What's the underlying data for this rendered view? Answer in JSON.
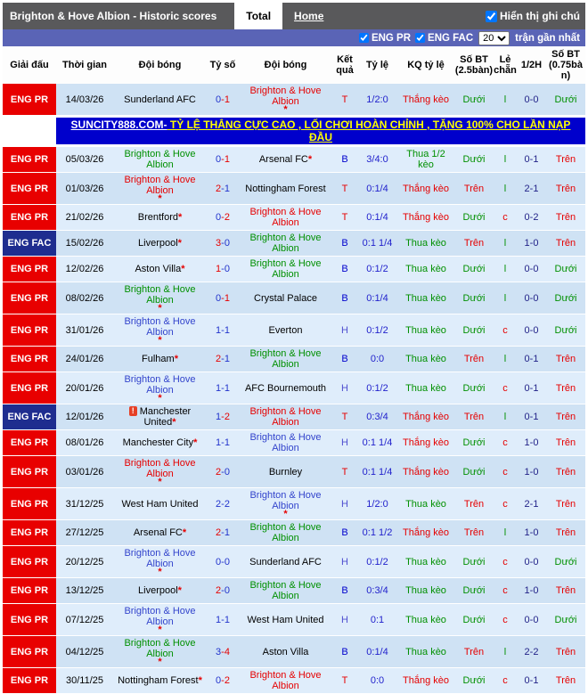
{
  "topbar": {
    "title": "Brighton & Hove Albion - Historic scores",
    "tabs": [
      {
        "label": "Total",
        "active": true
      },
      {
        "label": "Home",
        "active": false
      }
    ],
    "note_checkbox_label": "Hiển thị ghi chú"
  },
  "filterbar": {
    "checkboxes": [
      {
        "label": "ENG PR",
        "checked": true
      },
      {
        "label": "ENG FAC",
        "checked": true
      }
    ],
    "match_count_value": "20",
    "suffix_label": "trận gần nhất"
  },
  "symbols": {
    "star": "*",
    "red_card": "!",
    "dash": "-"
  },
  "colors": {
    "league_pr_bg": "#e80000",
    "league_fac_bg": "#1e2d8f",
    "team_win": "#e60000",
    "team_loss": "#009000",
    "team_draw": "#3344cc",
    "score_winner": "#e60000",
    "score_loser": "#2233cc",
    "over": "#e60000",
    "under": "#009000",
    "bar_blue": "#5a64b6",
    "topbar_gray": "#59595b",
    "ad_bg": "#0000cc",
    "ad_text": "#ffff00"
  },
  "table": {
    "headers": [
      "Giải đấu",
      "Thời gian",
      "Đội bóng",
      "Tỷ số",
      "Đội bóng",
      "Kết quả",
      "Tỷ lệ",
      "KQ tỷ lệ",
      "Số BT (2.5bàn)",
      "Lẻ chẵn",
      "1/2H",
      "Số BT (0.75bàn)"
    ],
    "ad_row": {
      "text_prefix": "SUNCITY888.COM-",
      "text_main": " TỶ LỆ THẮNG CỰC CAO , LỐI CHƠI HOÀN CHỈNH , TẶNG 100% CHO LẦN NẠP ĐẦU"
    },
    "rows": [
      {
        "league": "ENG PR",
        "lstyle": "pr",
        "date": "14/03/26",
        "home": {
          "name": "Sunderland AFC",
          "result": "none"
        },
        "score": {
          "h": "0",
          "a": "1"
        },
        "away": {
          "name": "Brighton & Hove Albion",
          "result": "win",
          "star": true,
          "star_below": true
        },
        "result": "T",
        "odds": "1/2:0",
        "odds_result": "Thắng kèo",
        "over25": "Dưới",
        "odd_even": "l",
        "half": "0-0",
        "over075": "Dưới"
      },
      {
        "league": "ENG PR",
        "lstyle": "pr",
        "date": "05/03/26",
        "home": {
          "name": "Brighton & Hove Albion",
          "result": "loss"
        },
        "score": {
          "h": "0",
          "a": "1"
        },
        "away": {
          "name": "Arsenal FC",
          "result": "none",
          "star": true
        },
        "result": "B",
        "odds": "3/4:0",
        "odds_result": "Thua 1/2 kèo",
        "over25": "Dưới",
        "odd_even": "l",
        "half": "0-1",
        "over075": "Trên"
      },
      {
        "league": "ENG PR",
        "lstyle": "pr",
        "date": "01/03/26",
        "home": {
          "name": "Brighton & Hove Albion",
          "result": "win",
          "star": true,
          "star_below": true
        },
        "score": {
          "h": "2",
          "a": "1"
        },
        "away": {
          "name": "Nottingham Forest",
          "result": "none"
        },
        "result": "T",
        "odds": "0:1/4",
        "odds_result": "Thắng kèo",
        "over25": "Trên",
        "odd_even": "l",
        "half": "2-1",
        "over075": "Trên"
      },
      {
        "league": "ENG PR",
        "lstyle": "pr",
        "date": "21/02/26",
        "home": {
          "name": "Brentford",
          "result": "none",
          "star": true
        },
        "score": {
          "h": "0",
          "a": "2"
        },
        "away": {
          "name": "Brighton & Hove Albion",
          "result": "win"
        },
        "result": "T",
        "odds": "0:1/4",
        "odds_result": "Thắng kèo",
        "over25": "Dưới",
        "odd_even": "c",
        "half": "0-2",
        "over075": "Trên"
      },
      {
        "league": "ENG FAC",
        "lstyle": "fac",
        "date": "15/02/26",
        "home": {
          "name": "Liverpool",
          "result": "none",
          "star": true
        },
        "score": {
          "h": "3",
          "a": "0"
        },
        "away": {
          "name": "Brighton & Hove Albion",
          "result": "loss"
        },
        "result": "B",
        "odds": "0:1 1/4",
        "odds_result": "Thua kèo",
        "over25": "Trên",
        "odd_even": "l",
        "half": "1-0",
        "over075": "Trên"
      },
      {
        "league": "ENG PR",
        "lstyle": "pr",
        "date": "12/02/26",
        "home": {
          "name": "Aston Villa",
          "result": "none",
          "star": true
        },
        "score": {
          "h": "1",
          "a": "0"
        },
        "away": {
          "name": "Brighton & Hove Albion",
          "result": "loss"
        },
        "result": "B",
        "odds": "0:1/2",
        "odds_result": "Thua kèo",
        "over25": "Dưới",
        "odd_even": "l",
        "half": "0-0",
        "over075": "Dưới"
      },
      {
        "league": "ENG PR",
        "lstyle": "pr",
        "date": "08/02/26",
        "home": {
          "name": "Brighton & Hove Albion",
          "result": "loss",
          "star": true,
          "star_below": true
        },
        "score": {
          "h": "0",
          "a": "1"
        },
        "away": {
          "name": "Crystal Palace",
          "result": "none"
        },
        "result": "B",
        "odds": "0:1/4",
        "odds_result": "Thua kèo",
        "over25": "Dưới",
        "odd_even": "l",
        "half": "0-0",
        "over075": "Dưới"
      },
      {
        "league": "ENG PR",
        "lstyle": "pr",
        "date": "31/01/26",
        "home": {
          "name": "Brighton & Hove Albion",
          "result": "draw",
          "star": true,
          "star_below": true
        },
        "score": {
          "h": "1",
          "a": "1"
        },
        "away": {
          "name": "Everton",
          "result": "none"
        },
        "result": "H",
        "odds": "0:1/2",
        "odds_result": "Thua kèo",
        "over25": "Dưới",
        "odd_even": "c",
        "half": "0-0",
        "over075": "Dưới"
      },
      {
        "league": "ENG PR",
        "lstyle": "pr",
        "date": "24/01/26",
        "home": {
          "name": "Fulham",
          "result": "none",
          "star": true
        },
        "score": {
          "h": "2",
          "a": "1"
        },
        "away": {
          "name": "Brighton & Hove Albion",
          "result": "loss"
        },
        "result": "B",
        "odds": "0:0",
        "odds_result": "Thua kèo",
        "over25": "Trên",
        "odd_even": "l",
        "half": "0-1",
        "over075": "Trên"
      },
      {
        "league": "ENG PR",
        "lstyle": "pr",
        "date": "20/01/26",
        "home": {
          "name": "Brighton & Hove Albion",
          "result": "draw",
          "star": true,
          "star_below": true
        },
        "score": {
          "h": "1",
          "a": "1"
        },
        "away": {
          "name": "AFC Bournemouth",
          "result": "none"
        },
        "result": "H",
        "odds": "0:1/2",
        "odds_result": "Thua kèo",
        "over25": "Dưới",
        "odd_even": "c",
        "half": "0-1",
        "over075": "Trên"
      },
      {
        "league": "ENG FAC",
        "lstyle": "fac",
        "date": "12/01/26",
        "home": {
          "name": "Manchester United",
          "result": "none",
          "star": true,
          "icon": true
        },
        "score": {
          "h": "1",
          "a": "2"
        },
        "away": {
          "name": "Brighton & Hove Albion",
          "result": "win"
        },
        "result": "T",
        "odds": "0:3/4",
        "odds_result": "Thắng kèo",
        "over25": "Trên",
        "odd_even": "l",
        "half": "0-1",
        "over075": "Trên"
      },
      {
        "league": "ENG PR",
        "lstyle": "pr",
        "date": "08/01/26",
        "home": {
          "name": "Manchester City",
          "result": "none",
          "star": true
        },
        "score": {
          "h": "1",
          "a": "1"
        },
        "away": {
          "name": "Brighton & Hove Albion",
          "result": "draw"
        },
        "result": "H",
        "odds": "0:1 1/4",
        "odds_result": "Thắng kèo",
        "over25": "Dưới",
        "odd_even": "c",
        "half": "1-0",
        "over075": "Trên"
      },
      {
        "league": "ENG PR",
        "lstyle": "pr",
        "date": "03/01/26",
        "home": {
          "name": "Brighton & Hove Albion",
          "result": "win",
          "star": true,
          "star_below": true
        },
        "score": {
          "h": "2",
          "a": "0"
        },
        "away": {
          "name": "Burnley",
          "result": "none"
        },
        "result": "T",
        "odds": "0:1 1/4",
        "odds_result": "Thắng kèo",
        "over25": "Dưới",
        "odd_even": "c",
        "half": "1-0",
        "over075": "Trên"
      },
      {
        "league": "ENG PR",
        "lstyle": "pr",
        "date": "31/12/25",
        "home": {
          "name": "West Ham United",
          "result": "none"
        },
        "score": {
          "h": "2",
          "a": "2"
        },
        "away": {
          "name": "Brighton & Hove Albion",
          "result": "draw",
          "star": true,
          "star_below": true
        },
        "result": "H",
        "odds": "1/2:0",
        "odds_result": "Thua kèo",
        "over25": "Trên",
        "odd_even": "c",
        "half": "2-1",
        "over075": "Trên"
      },
      {
        "league": "ENG PR",
        "lstyle": "pr",
        "date": "27/12/25",
        "home": {
          "name": "Arsenal FC",
          "result": "none",
          "star": true
        },
        "score": {
          "h": "2",
          "a": "1"
        },
        "away": {
          "name": "Brighton & Hove Albion",
          "result": "loss"
        },
        "result": "B",
        "odds": "0:1 1/2",
        "odds_result": "Thắng kèo",
        "over25": "Trên",
        "odd_even": "l",
        "half": "1-0",
        "over075": "Trên"
      },
      {
        "league": "ENG PR",
        "lstyle": "pr",
        "date": "20/12/25",
        "home": {
          "name": "Brighton & Hove Albion",
          "result": "draw",
          "star": true,
          "star_below": true
        },
        "score": {
          "h": "0",
          "a": "0"
        },
        "away": {
          "name": "Sunderland AFC",
          "result": "none"
        },
        "result": "H",
        "odds": "0:1/2",
        "odds_result": "Thua kèo",
        "over25": "Dưới",
        "odd_even": "c",
        "half": "0-0",
        "over075": "Dưới"
      },
      {
        "league": "ENG PR",
        "lstyle": "pr",
        "date": "13/12/25",
        "home": {
          "name": "Liverpool",
          "result": "none",
          "star": true
        },
        "score": {
          "h": "2",
          "a": "0"
        },
        "away": {
          "name": "Brighton & Hove Albion",
          "result": "loss"
        },
        "result": "B",
        "odds": "0:3/4",
        "odds_result": "Thua kèo",
        "over25": "Dưới",
        "odd_even": "c",
        "half": "1-0",
        "over075": "Trên"
      },
      {
        "league": "ENG PR",
        "lstyle": "pr",
        "date": "07/12/25",
        "home": {
          "name": "Brighton & Hove Albion",
          "result": "draw",
          "star": true,
          "star_below": true
        },
        "score": {
          "h": "1",
          "a": "1"
        },
        "away": {
          "name": "West Ham United",
          "result": "none"
        },
        "result": "H",
        "odds": "0:1",
        "odds_result": "Thua kèo",
        "over25": "Dưới",
        "odd_even": "c",
        "half": "0-0",
        "over075": "Dưới"
      },
      {
        "league": "ENG PR",
        "lstyle": "pr",
        "date": "04/12/25",
        "home": {
          "name": "Brighton & Hove Albion",
          "result": "loss",
          "star": true,
          "star_below": true
        },
        "score": {
          "h": "3",
          "a": "4"
        },
        "away": {
          "name": "Aston Villa",
          "result": "none"
        },
        "result": "B",
        "odds": "0:1/4",
        "odds_result": "Thua kèo",
        "over25": "Trên",
        "odd_even": "l",
        "half": "2-2",
        "over075": "Trên"
      },
      {
        "league": "ENG PR",
        "lstyle": "pr",
        "date": "30/11/25",
        "home": {
          "name": "Nottingham Forest",
          "result": "none",
          "star": true
        },
        "score": {
          "h": "0",
          "a": "2"
        },
        "away": {
          "name": "Brighton & Hove Albion",
          "result": "win"
        },
        "result": "T",
        "odds": "0:0",
        "odds_result": "Thắng kèo",
        "over25": "Dưới",
        "odd_even": "c",
        "half": "0-1",
        "over075": "Trên"
      }
    ]
  }
}
